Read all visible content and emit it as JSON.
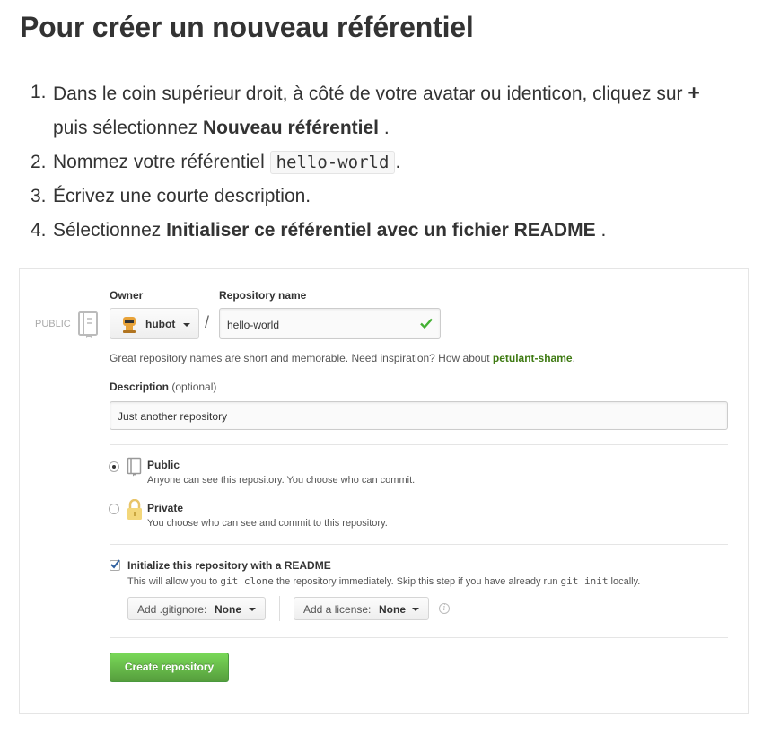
{
  "doc": {
    "title": "Pour créer un nouveau référentiel",
    "steps": [
      {
        "num": "1.",
        "pre": "Dans le coin supérieur droit, à côté de votre avatar ou identicon, cliquez sur ",
        "plus": "+",
        "line2_pre": "puis sélectionnez ",
        "bold": "Nouveau référentiel",
        "post": " ."
      },
      {
        "num": "2.",
        "pre": "Nommez votre référentiel ",
        "code": "hello-world",
        "post": "."
      },
      {
        "num": "3.",
        "text": "Écrivez une courte description."
      },
      {
        "num": "4.",
        "pre": "Sélectionnez ",
        "bold": "Initialiser ce référentiel avec un fichier README",
        "post": " ."
      }
    ]
  },
  "form": {
    "public_label": "PUBLIC",
    "owner_label": "Owner",
    "owner_value": "hubot",
    "separator": "/",
    "repo_label": "Repository name",
    "repo_value": "hello-world",
    "hint_text": "Great repository names are short and memorable. Need inspiration? How about ",
    "hint_suggestion": "petulant-shame",
    "hint_end": ".",
    "description_label": "Description",
    "description_optional": "(optional)",
    "description_value": "Just another repository",
    "public_option": {
      "title": "Public",
      "desc": "Anyone can see this repository. You choose who can commit.",
      "selected": true
    },
    "private_option": {
      "title": "Private",
      "desc": "You choose who can see and commit to this repository.",
      "selected": false
    },
    "init_readme": {
      "label": "Initialize this repository with a README",
      "checked": true,
      "desc_pre": "This will allow you to ",
      "desc_code1": "git clone",
      "desc_mid": " the repository immediately. Skip this step if you have already run ",
      "desc_code2": "git init",
      "desc_post": " locally."
    },
    "gitignore": {
      "label": "Add .gitignore:",
      "value": "None"
    },
    "license": {
      "label": "Add a license:",
      "value": "None"
    },
    "info_glyph": "i",
    "create_button": "Create repository",
    "colors": {
      "suggestion": "#3e7a12",
      "checkmark": "#44b134",
      "button": "#60b044"
    }
  }
}
